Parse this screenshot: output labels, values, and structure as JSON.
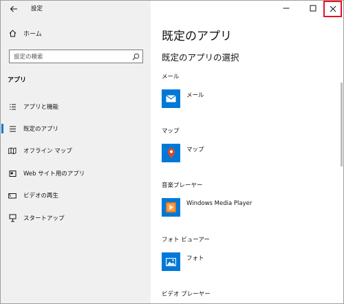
{
  "window": {
    "title": "設定"
  },
  "sidebar": {
    "home_label": "ホーム",
    "search_placeholder": "設定の検索",
    "section_title": "アプリ",
    "items": [
      {
        "label": "アプリと機能",
        "icon": "list-icon"
      },
      {
        "label": "既定のアプリ",
        "icon": "default-apps-icon",
        "selected": true
      },
      {
        "label": "オフライン マップ",
        "icon": "offline-map-icon"
      },
      {
        "label": "Web サイト用のアプリ",
        "icon": "web-apps-icon"
      },
      {
        "label": "ビデオの再生",
        "icon": "video-icon"
      },
      {
        "label": "スタートアップ",
        "icon": "startup-icon"
      }
    ]
  },
  "main": {
    "page_title": "既定のアプリ",
    "subtitle": "既定のアプリの選択",
    "categories": [
      {
        "label": "メール",
        "app": "メール",
        "icon": "mail-icon"
      },
      {
        "label": "マップ",
        "app": "マップ",
        "icon": "map-pin-icon"
      },
      {
        "label": "音楽プレーヤー",
        "app": "Windows Media Player",
        "icon": "media-player-icon"
      },
      {
        "label": "フォト ビューアー",
        "app": "フォト",
        "icon": "photos-icon"
      },
      {
        "label": "ビデオ プレーヤー"
      }
    ]
  },
  "colors": {
    "accent": "#0078d7",
    "sidebar_bg": "#f0f0f0",
    "close_highlight": "#e81123",
    "map_pin": "#d9482f",
    "media_player": "#e8791e"
  }
}
